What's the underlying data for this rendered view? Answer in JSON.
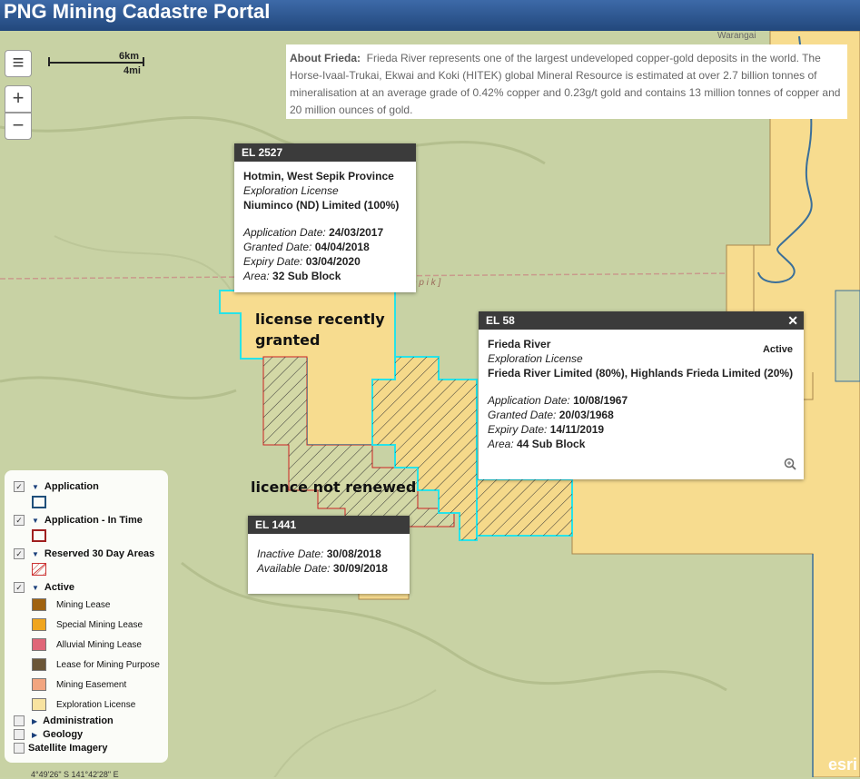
{
  "header": {
    "title": "PNG Mining Cadastre Portal"
  },
  "scale": {
    "km": "6km",
    "mi": "4mi"
  },
  "controls": {
    "menu_icon": "menu-icon",
    "zoom_in": "+",
    "zoom_out": "−"
  },
  "map_labels": {
    "warangai": "Warangai",
    "sepik": "e p i k ]"
  },
  "about": {
    "label": "About Frieda:",
    "text": "Frieda River represents one of the largest undeveloped copper-gold deposits in the world. The Horse-Ivaal-Trukai, Ekwai and Koki (HITEK) global Mineral Resource is estimated at over 2.7 billion tonnes of mineralisation at an average grade of 0.42% copper and 0.23g/t gold and contains 13 million tonnes of copper and 20 million ounces of gold."
  },
  "popup_el2527": {
    "id": "EL 2527",
    "location": "Hotmin, West Sepik Province",
    "type": "Exploration License",
    "holder": "Niuminco (ND) Limited (100%)",
    "app_label": "Application Date:",
    "app_value": "24/03/2017",
    "granted_label": "Granted Date:",
    "granted_value": "04/04/2018",
    "expiry_label": "Expiry Date:",
    "expiry_value": "03/04/2020",
    "area_label": "Area:",
    "area_value": "32 Sub Block"
  },
  "popup_el58": {
    "id": "EL 58",
    "name": "Frieda River",
    "status": "Active",
    "type": "Exploration License",
    "holder": "Frieda River Limited (80%), Highlands Frieda Limited (20%)",
    "app_label": "Application Date:",
    "app_value": "10/08/1967",
    "granted_label": "Granted Date:",
    "granted_value": "20/03/1968",
    "expiry_label": "Expiry Date:",
    "expiry_value": "14/11/2019",
    "area_label": "Area:",
    "area_value": "44 Sub Block",
    "close": "✕"
  },
  "popup_el1441": {
    "id": "EL 1441",
    "inactive_label": "Inactive Date:",
    "inactive_value": "30/08/2018",
    "available_label": "Available Date:",
    "available_value": "30/09/2018"
  },
  "annotations": {
    "recent": "license recently granted",
    "recent_line1": "license recently",
    "recent_line2": "granted",
    "not_renewed": "licence not renewed"
  },
  "legend": {
    "application": "Application",
    "application_in_time": "Application - In Time",
    "reserved": "Reserved 30 Day Areas",
    "active": "Active",
    "active_items": [
      {
        "label": "Mining Lease",
        "color": "#a0620f"
      },
      {
        "label": "Special Mining Lease",
        "color": "#f0a51e"
      },
      {
        "label": "Alluvial Mining Lease",
        "color": "#e06678"
      },
      {
        "label": "Lease for Mining Purpose",
        "color": "#6b5637"
      },
      {
        "label": "Mining Easement",
        "color": "#f2a57f"
      },
      {
        "label": "Exploration License",
        "color": "#f8e3a0"
      }
    ],
    "administration": "Administration",
    "geology": "Geology",
    "satellite": "Satellite Imagery"
  },
  "coords": "4°49'26\" S 141°42'28\" E",
  "esri": "esri",
  "colors": {
    "exploration_fill": "#f7dc8f",
    "cyan_outline": "#27e3e8",
    "red_outline": "#cc2222",
    "river": "#3a6f9a"
  }
}
